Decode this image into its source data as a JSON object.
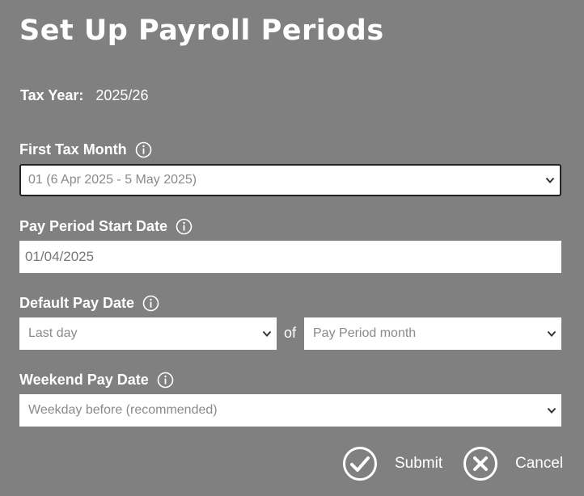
{
  "title": "Set Up Payroll Periods",
  "tax_year": {
    "label": "Tax Year:",
    "value": "2025/26"
  },
  "first_tax_month": {
    "label": "First Tax Month",
    "selected": "01 (6 Apr 2025 - 5 May 2025)"
  },
  "pay_period_start": {
    "label": "Pay Period Start Date",
    "value": "01/04/2025"
  },
  "default_pay_date": {
    "label": "Default Pay Date",
    "day_selected": "Last day",
    "of_label": "of",
    "month_selected": "Pay Period month"
  },
  "weekend_pay_date": {
    "label": "Weekend Pay Date",
    "selected": "Weekday before (recommended)"
  },
  "actions": {
    "submit_label": "Submit",
    "cancel_label": "Cancel"
  },
  "icons": {
    "info": "info-circle-icon",
    "chevron": "chevron-down-icon",
    "submit": "check-circle-icon",
    "cancel": "close-circle-icon"
  },
  "colors": {
    "background": "#808080",
    "text": "#ffffff",
    "field_bg": "#ffffff",
    "field_text": "#8a8a8a"
  }
}
